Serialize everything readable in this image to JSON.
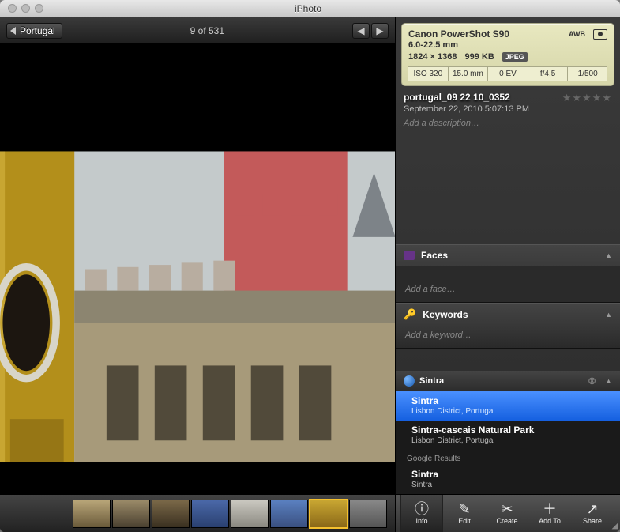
{
  "app_title": "iPhoto",
  "header": {
    "breadcrumb": "Portugal",
    "count": "9 of 531"
  },
  "exif": {
    "camera": "Canon PowerShot S90",
    "lens": "6.0-22.5 mm",
    "dimensions": "1824 × 1368",
    "filesize": "999 KB",
    "format_badge": "JPEG",
    "awb_badge": "AWB",
    "iso": "ISO 320",
    "focal": "15.0 mm",
    "ev": "0 EV",
    "aperture": "f/4.5",
    "shutter": "1/500"
  },
  "meta": {
    "filename": "portugal_09 22 10_0352",
    "date": "September 22, 2010 5:07:13 PM",
    "description_placeholder": "Add a description…"
  },
  "sections": {
    "faces": {
      "title": "Faces",
      "placeholder": "Add a face…"
    },
    "keywords": {
      "title": "Keywords",
      "placeholder": "Add a keyword…"
    }
  },
  "location": {
    "input_value": "Sintra",
    "items": [
      {
        "title": "Sintra",
        "sub": "Lisbon District, Portugal"
      },
      {
        "title": "Sintra-cascais Natural Park",
        "sub": "Lisbon District, Portugal"
      }
    ],
    "google_label": "Google Results",
    "google_items": [
      {
        "title": "Sintra",
        "sub": "Sintra"
      }
    ]
  },
  "toolbar": {
    "info": "Info",
    "edit": "Edit",
    "create": "Create",
    "addto": "Add To",
    "share": "Share"
  }
}
